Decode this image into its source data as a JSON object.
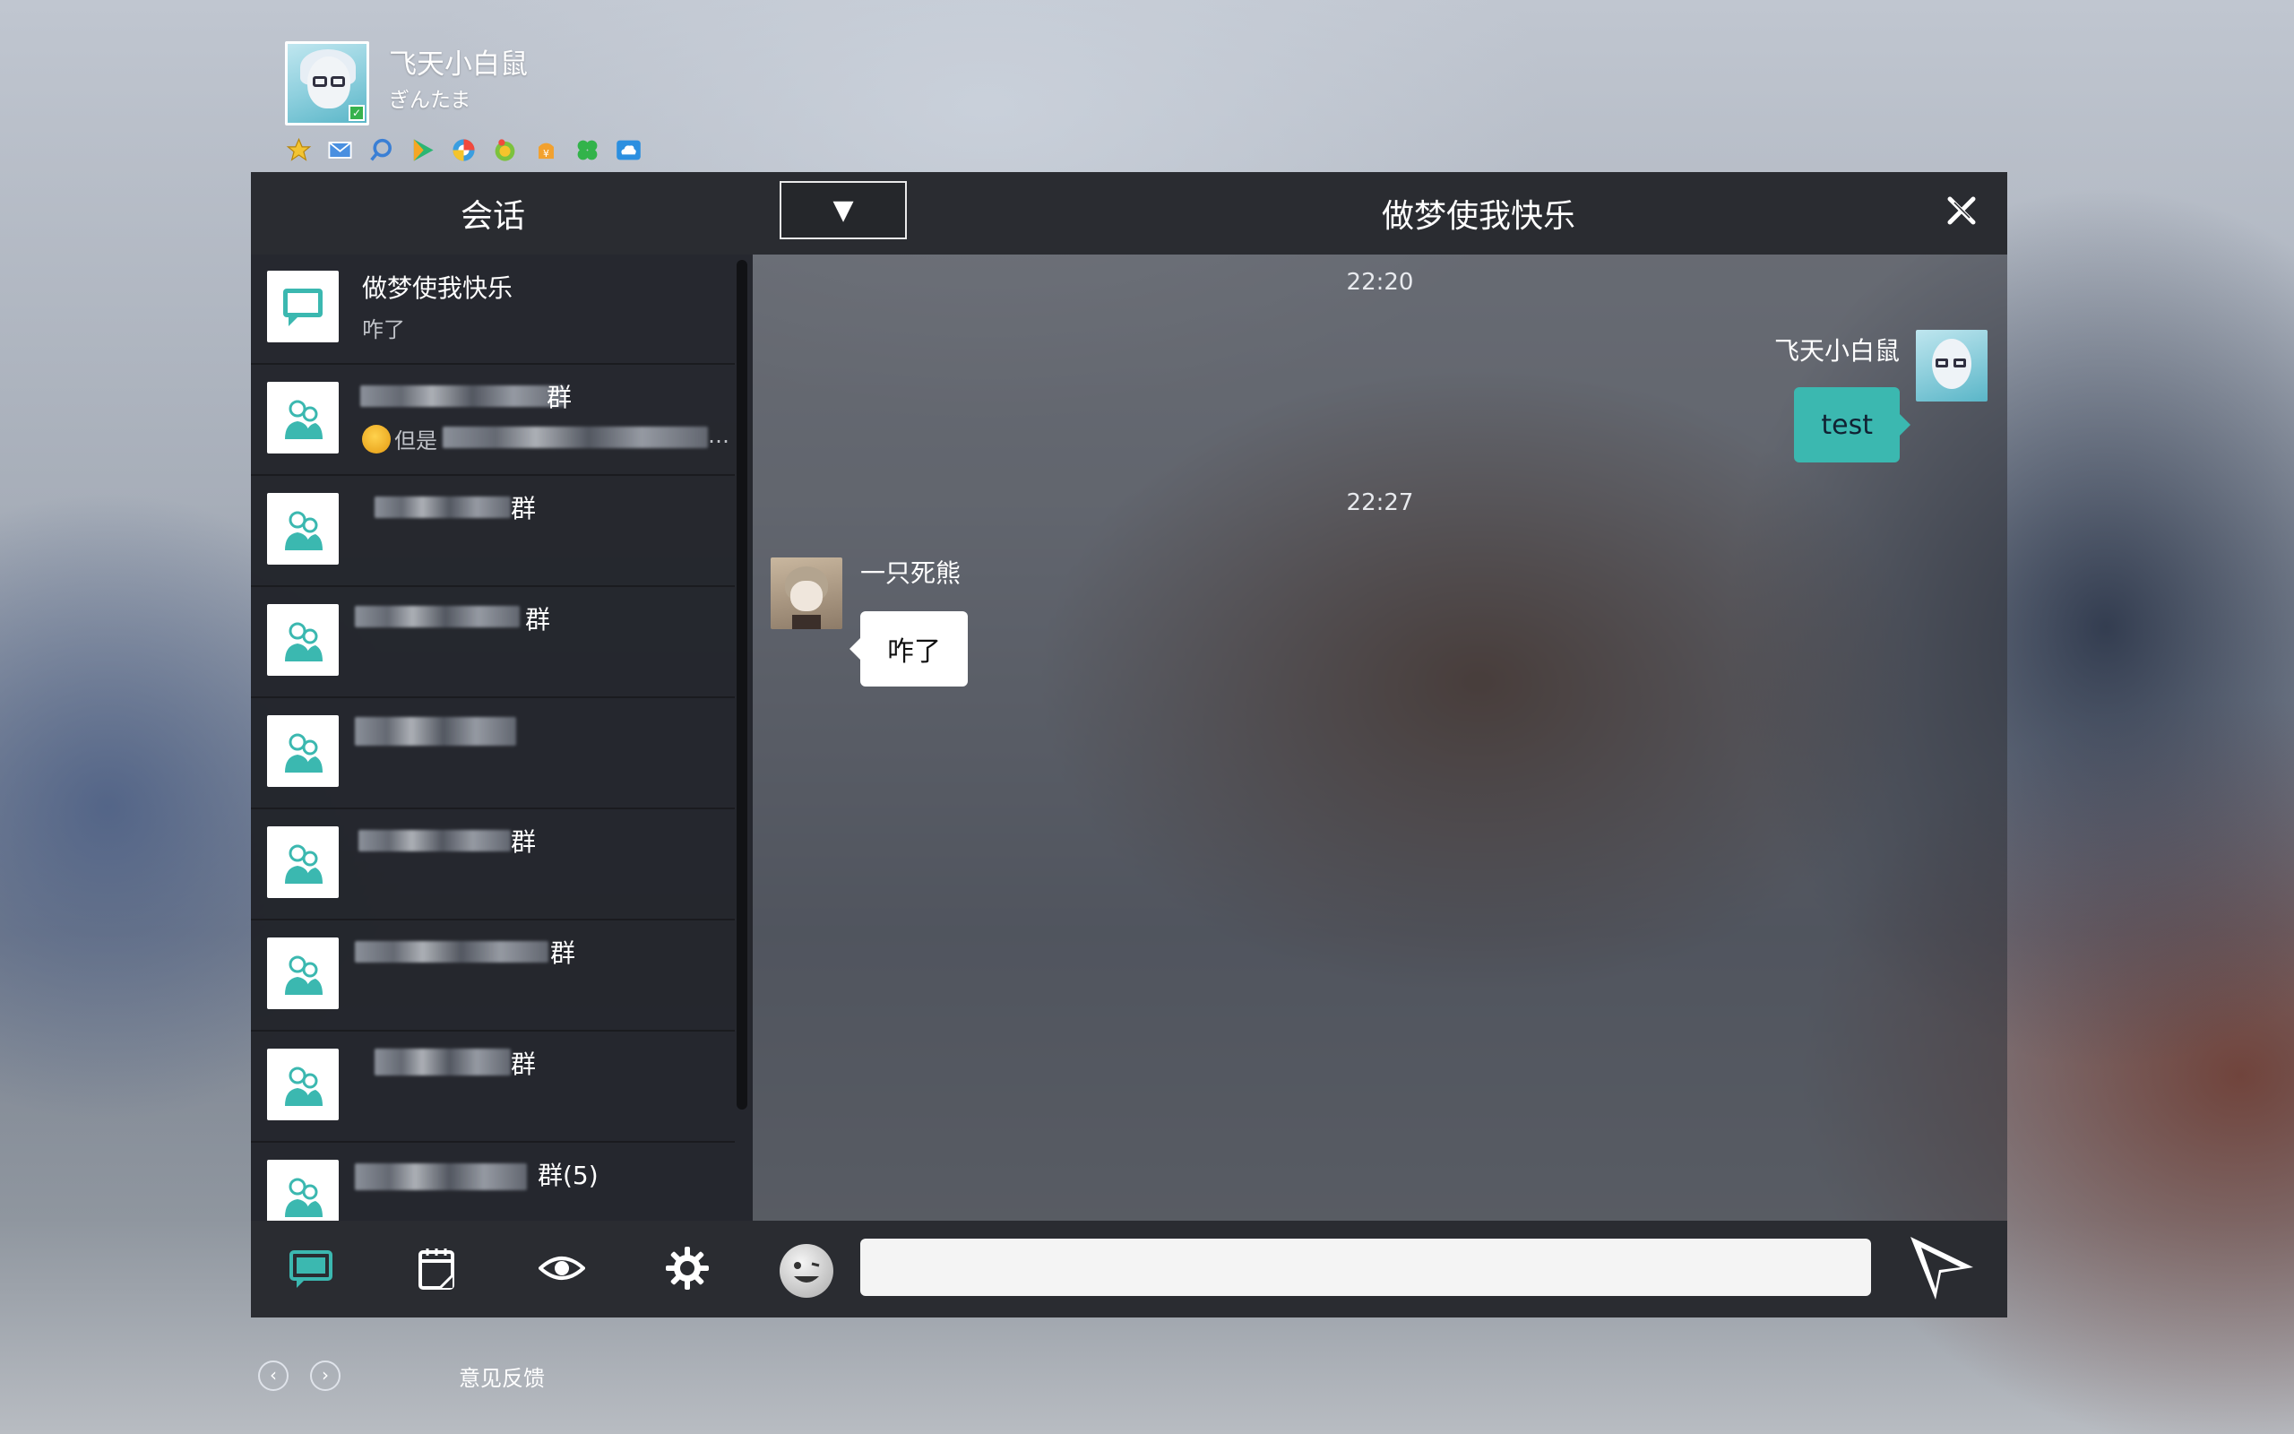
{
  "profile": {
    "name": "飞天小白鼠",
    "signature": "ぎんたま",
    "app_icons": [
      "star-icon",
      "mail-icon",
      "search-icon",
      "play-icon",
      "browser-icon",
      "game-icon",
      "wallet-icon",
      "clover-icon",
      "cloud-icon"
    ]
  },
  "header": {
    "sessions_tab": "会话",
    "dropdown_symbol": "▼",
    "chat_title": "做梦使我快乐"
  },
  "conversations": [
    {
      "name": "做梦使我快乐",
      "preview": "咋了"
    },
    {
      "name_suffix": "群",
      "preview_prefix": "但是",
      "preview_suffix": "…"
    },
    {
      "name_suffix": "群"
    },
    {
      "name_suffix": "群"
    },
    {
      "name_suffix": ""
    },
    {
      "name_suffix": "群"
    },
    {
      "name_suffix": "群"
    },
    {
      "name_suffix": "群"
    },
    {
      "name_suffix": "群(5)"
    }
  ],
  "messages": {
    "time1": "22:20",
    "me_name": "飞天小白鼠",
    "me_text": "test",
    "time2": "22:27",
    "other_name": "一只死熊",
    "other_text": "咋了"
  },
  "input": {
    "placeholder": "",
    "value": ""
  },
  "footer": {
    "back": "‹",
    "forward": "›",
    "feedback": "意见反馈"
  },
  "colors": {
    "accent": "#3bb8b0",
    "topbar": "#2a2c31",
    "list_bg": "#22242a"
  }
}
